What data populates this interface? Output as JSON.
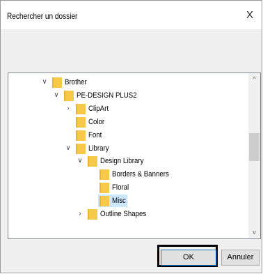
{
  "window": {
    "title": "Rechercher un dossier",
    "close_glyph": "X"
  },
  "tree": {
    "items": [
      {
        "label": "Brother",
        "depth": 0,
        "expander": "expanded"
      },
      {
        "label": "PE-DESIGN PLUS2",
        "depth": 1,
        "expander": "expanded"
      },
      {
        "label": "ClipArt",
        "depth": 2,
        "expander": "collapsed"
      },
      {
        "label": "Color",
        "depth": 2,
        "expander": "none"
      },
      {
        "label": "Font",
        "depth": 2,
        "expander": "none"
      },
      {
        "label": "Library",
        "depth": 2,
        "expander": "expanded"
      },
      {
        "label": "Design Library",
        "depth": 3,
        "expander": "expanded"
      },
      {
        "label": "Borders & Banners",
        "depth": 4,
        "expander": "none"
      },
      {
        "label": "Floral",
        "depth": 4,
        "expander": "none"
      },
      {
        "label": "Misc",
        "depth": 4,
        "expander": "none",
        "selected": true
      },
      {
        "label": "Outline Shapes",
        "depth": 3,
        "expander": "collapsed"
      }
    ],
    "scroll_up_glyph": "^",
    "scroll_down_glyph": "v"
  },
  "buttons": {
    "ok_label": "OK",
    "cancel_label": "Annuler"
  },
  "colors": {
    "folder": "#f7c948",
    "selection": "#cce8ff",
    "focus_border": "#000000"
  }
}
